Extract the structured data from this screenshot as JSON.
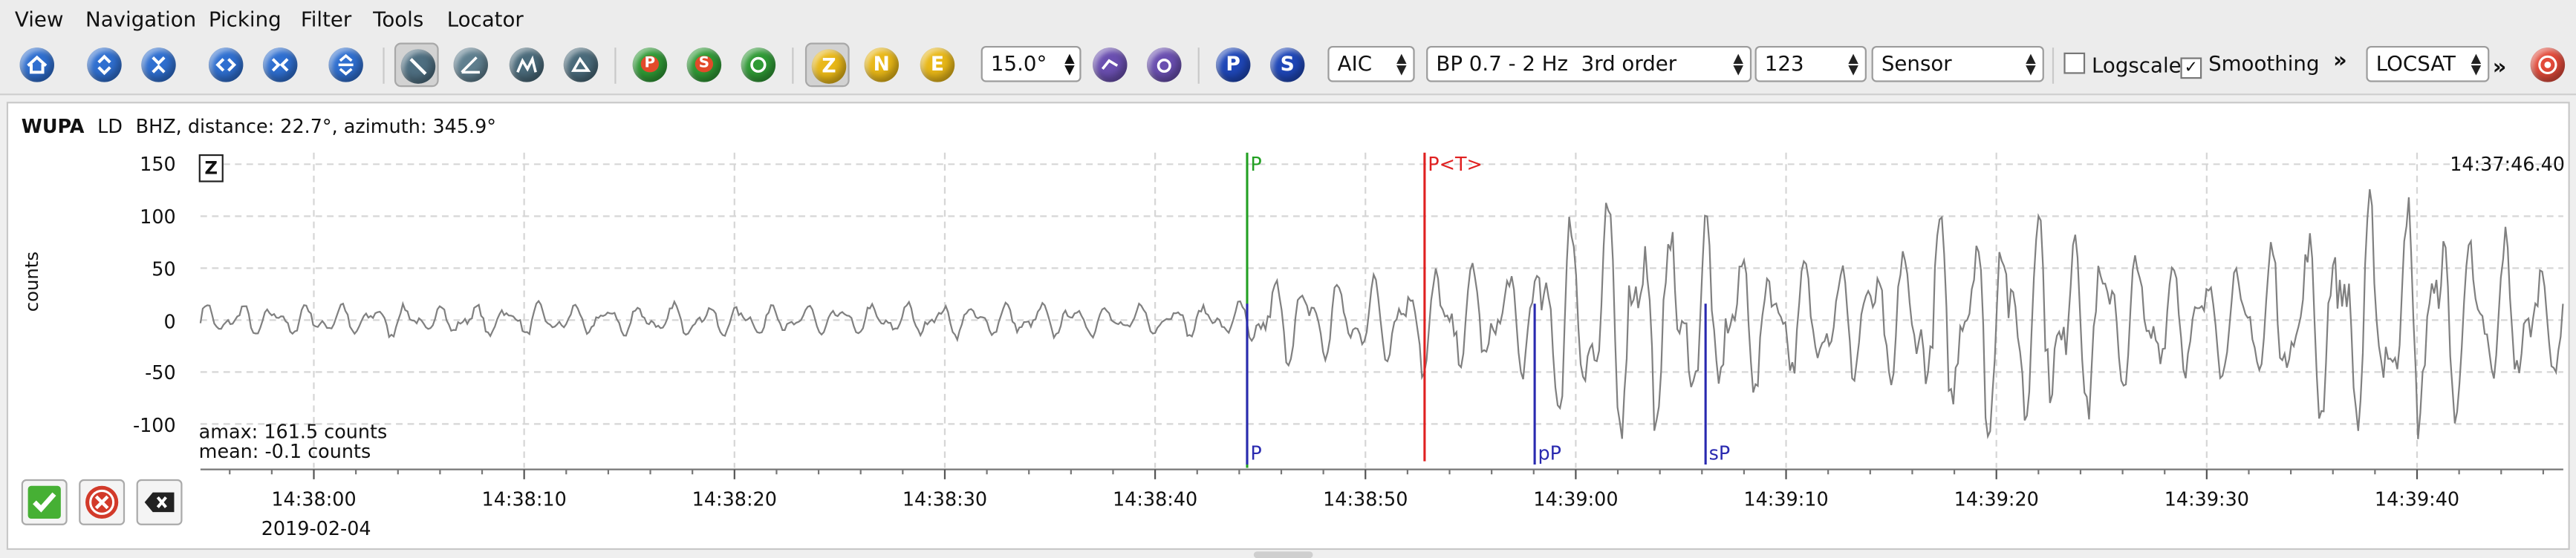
{
  "menu": [
    "View",
    "Navigation",
    "Picking",
    "Filter",
    "Tools",
    "Locator"
  ],
  "toolbar": {
    "component_buttons": [
      "Z",
      "N",
      "E"
    ],
    "phase_buttons": [
      "P",
      "S"
    ],
    "zoom_value": "15.0°",
    "picker_method": "AIC",
    "filter": "BP 0.7 - 2 Hz  3rd order",
    "number_field": "123",
    "amplitude_mode": "Sensor",
    "logscale_label": "Logscale",
    "smoothing_label": "Smoothing",
    "logscale_checked": false,
    "smoothing_checked": true,
    "locator": "LOCSAT",
    "overflow": "»"
  },
  "trace": {
    "station_code": "WUPA",
    "network": "LD",
    "channel_info": "BHZ, distance: 22.7°, azimuth: 345.9°",
    "component_badge": "Z",
    "time_label": "14:37:46.40",
    "y_axis_label": "counts",
    "y_ticks": [
      "150",
      "100",
      "50",
      "0",
      "-50",
      "-100"
    ],
    "x_ticks": [
      "14:38:00",
      "14:38:10",
      "14:38:20",
      "14:38:30",
      "14:38:40",
      "14:38:50",
      "14:39:00",
      "14:39:10",
      "14:39:20",
      "14:39:30",
      "14:39:40"
    ],
    "date": "2019-02-04",
    "amax": "amax: 161.5 counts",
    "mean": "mean: -0.1 counts"
  },
  "picks": [
    {
      "label": "P",
      "color": "#22a022",
      "where": "top"
    },
    {
      "label": "P<T>",
      "color": "#e02020",
      "where": "top"
    },
    {
      "label": "P",
      "color": "#2a2ab0",
      "where": "bottom"
    },
    {
      "label": "pP",
      "color": "#2a2ab0",
      "where": "bottom"
    },
    {
      "label": "sP",
      "color": "#2a2ab0",
      "where": "bottom"
    }
  ],
  "colors": {
    "accent_blue": "#2f6fd0",
    "trace": "#808080",
    "grid": "#d6d6d6"
  }
}
